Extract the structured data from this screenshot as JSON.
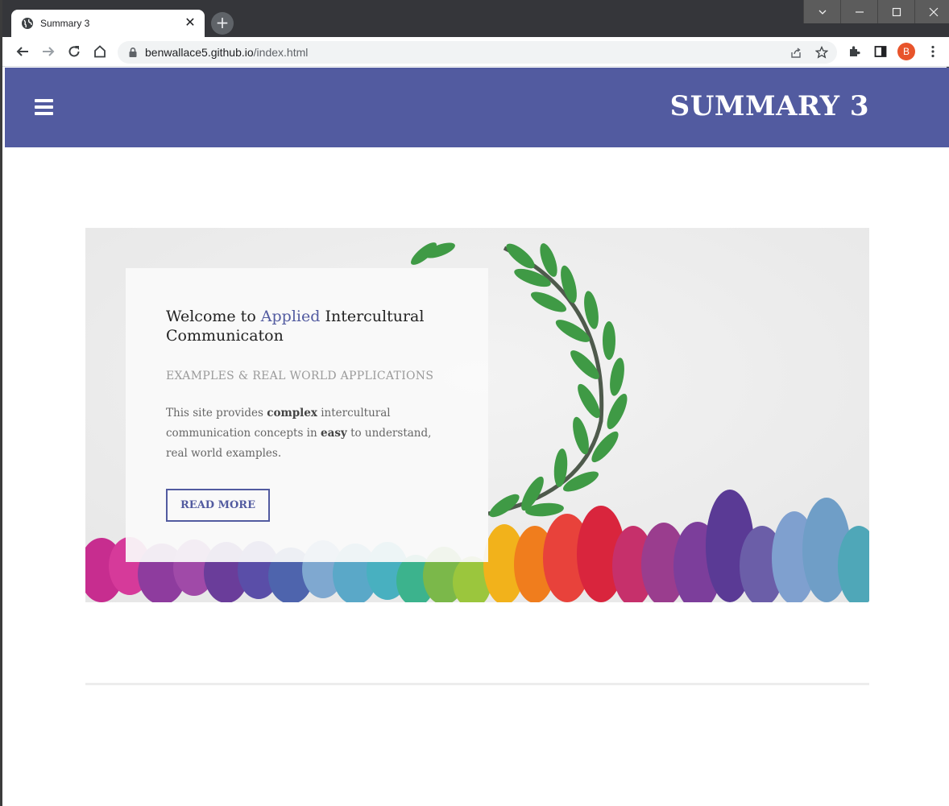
{
  "browser": {
    "tab_title": "Summary 3",
    "tab_close": "✕",
    "new_tab": "+",
    "url_host": "benwallace5.github.io",
    "url_path": "/index.html",
    "profile_initial": "B"
  },
  "site": {
    "brand_color": "#525ba0",
    "title": "SUMMARY 3"
  },
  "hero": {
    "heading_pre": "Welcome to ",
    "heading_accent": "Applied",
    "heading_post": " Intercultural Communicaton",
    "subheading": "EXAMPLES & REAL WORLD APPLICATIONS",
    "body_1": "This site provides ",
    "body_bold_1": "complex",
    "body_2": " intercultural communication concepts in ",
    "body_bold_2": "easy",
    "body_3": " to understand, real world examples.",
    "button_label": "READ MORE"
  }
}
